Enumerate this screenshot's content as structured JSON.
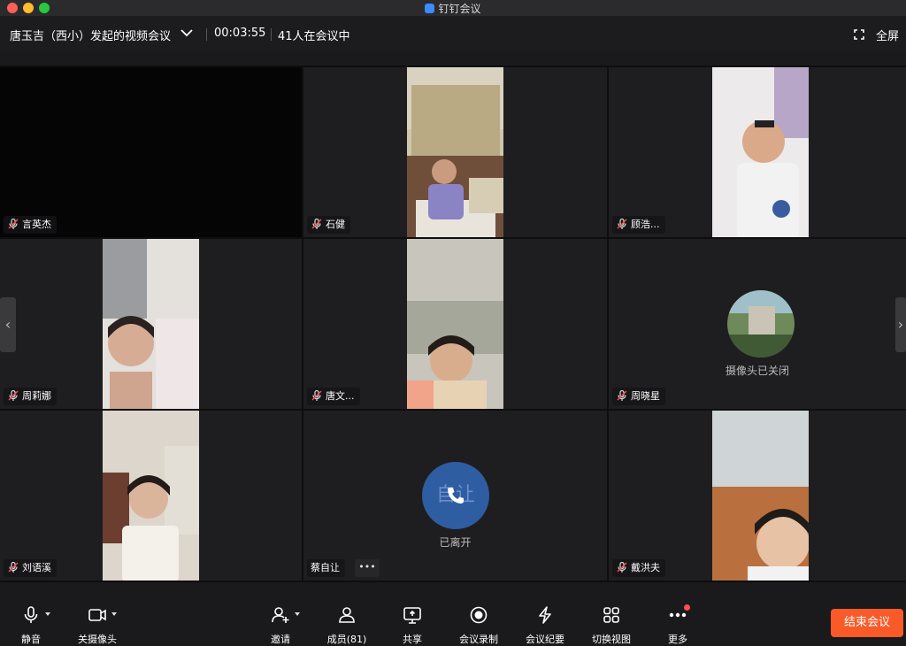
{
  "window": {
    "title": "钉钉会议"
  },
  "header": {
    "meeting_name": "唐玉吉（西小）发起的视频会议",
    "timer": "00:03:55",
    "participant_count": "41人在会议中",
    "fullscreen_label": "全屏"
  },
  "tiles": [
    {
      "name": "言英杰",
      "video": false
    },
    {
      "name": "石健",
      "video": true
    },
    {
      "name": "顾浩...",
      "video": true
    },
    {
      "name": "周莉娜",
      "video": true
    },
    {
      "name": "唐文...",
      "video": true
    },
    {
      "name": "周晓星",
      "video": false,
      "status": "摄像头已关闭"
    },
    {
      "name": "刘语溪",
      "video": true
    },
    {
      "name": "蔡自让",
      "video": false,
      "status": "已离开",
      "avatar_text": "自让"
    },
    {
      "name": "戴洪夫",
      "video": true
    }
  ],
  "toolbar": {
    "items": [
      {
        "label": "静音",
        "icon": "microphone-icon"
      },
      {
        "label": "关摄像头",
        "icon": "camera-icon"
      },
      {
        "label": "邀请",
        "icon": "add-person-icon"
      },
      {
        "label": "成员(81)",
        "icon": "members-icon"
      },
      {
        "label": "共享",
        "icon": "share-screen-icon"
      },
      {
        "label": "会议录制",
        "icon": "record-icon"
      },
      {
        "label": "会议纪要",
        "icon": "minutes-icon"
      },
      {
        "label": "切换视图",
        "icon": "grid-view-icon"
      },
      {
        "label": "更多",
        "icon": "more-icon"
      }
    ],
    "end_label": "结束会议"
  },
  "colors": {
    "accent": "#fa5a28",
    "avatar_blue": "#2f5da2",
    "background": "#1a1a1c"
  }
}
